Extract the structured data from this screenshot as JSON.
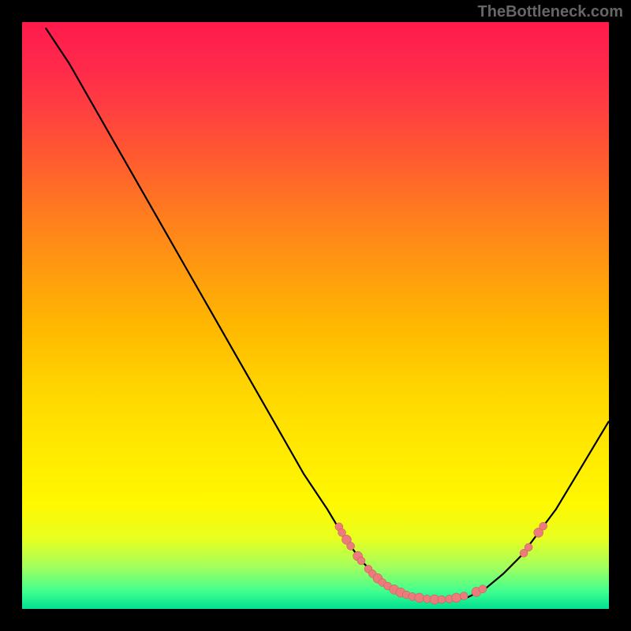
{
  "watermark": "TheBottleneck.com",
  "colors": {
    "curve": "#000000",
    "dot_fill": "#ec7b7b",
    "dot_stroke": "#c25555"
  },
  "chart_data": {
    "type": "line",
    "title": "",
    "xlabel": "",
    "ylabel": "",
    "xlim": [
      0,
      100
    ],
    "ylim": [
      0,
      100
    ],
    "note": "X and Y are normalized 0–100 across the plot area. Curve is a bottleneck V-shape; lower is better (green band at bottom).",
    "curve": [
      {
        "x": 4,
        "y": 99
      },
      {
        "x": 8,
        "y": 93
      },
      {
        "x": 12,
        "y": 86
      },
      {
        "x": 16,
        "y": 79
      },
      {
        "x": 20,
        "y": 72
      },
      {
        "x": 24,
        "y": 65
      },
      {
        "x": 28,
        "y": 58
      },
      {
        "x": 32,
        "y": 51
      },
      {
        "x": 36,
        "y": 44
      },
      {
        "x": 40,
        "y": 37
      },
      {
        "x": 44,
        "y": 30
      },
      {
        "x": 48,
        "y": 23
      },
      {
        "x": 52,
        "y": 17
      },
      {
        "x": 55,
        "y": 12
      },
      {
        "x": 58,
        "y": 8
      },
      {
        "x": 61,
        "y": 5
      },
      {
        "x": 64,
        "y": 3
      },
      {
        "x": 67,
        "y": 2
      },
      {
        "x": 70,
        "y": 1.5
      },
      {
        "x": 73,
        "y": 1.5
      },
      {
        "x": 76,
        "y": 2
      },
      {
        "x": 79,
        "y": 3.5
      },
      {
        "x": 82,
        "y": 6
      },
      {
        "x": 85,
        "y": 9
      },
      {
        "x": 88,
        "y": 13
      },
      {
        "x": 91,
        "y": 17
      },
      {
        "x": 94,
        "y": 22
      },
      {
        "x": 97,
        "y": 27
      },
      {
        "x": 100,
        "y": 32
      }
    ],
    "points": [
      {
        "x": 54.0,
        "y": 14.0,
        "r": 5
      },
      {
        "x": 54.5,
        "y": 13.0,
        "r": 5
      },
      {
        "x": 55.3,
        "y": 11.8,
        "r": 6
      },
      {
        "x": 56.0,
        "y": 10.7,
        "r": 5
      },
      {
        "x": 57.2,
        "y": 9.0,
        "r": 6
      },
      {
        "x": 57.8,
        "y": 8.2,
        "r": 5
      },
      {
        "x": 59.0,
        "y": 6.8,
        "r": 5
      },
      {
        "x": 59.7,
        "y": 6.0,
        "r": 5
      },
      {
        "x": 60.6,
        "y": 5.2,
        "r": 6
      },
      {
        "x": 61.4,
        "y": 4.5,
        "r": 5
      },
      {
        "x": 62.3,
        "y": 3.9,
        "r": 5
      },
      {
        "x": 63.4,
        "y": 3.3,
        "r": 6
      },
      {
        "x": 64.5,
        "y": 2.8,
        "r": 6
      },
      {
        "x": 65.5,
        "y": 2.4,
        "r": 5
      },
      {
        "x": 66.5,
        "y": 2.1,
        "r": 5
      },
      {
        "x": 67.7,
        "y": 1.9,
        "r": 6
      },
      {
        "x": 69.0,
        "y": 1.7,
        "r": 5
      },
      {
        "x": 70.3,
        "y": 1.6,
        "r": 6
      },
      {
        "x": 71.5,
        "y": 1.6,
        "r": 5
      },
      {
        "x": 72.8,
        "y": 1.7,
        "r": 5
      },
      {
        "x": 74.0,
        "y": 1.9,
        "r": 6
      },
      {
        "x": 75.3,
        "y": 2.2,
        "r": 5
      },
      {
        "x": 77.4,
        "y": 2.9,
        "r": 6
      },
      {
        "x": 78.5,
        "y": 3.4,
        "r": 5
      },
      {
        "x": 85.5,
        "y": 9.5,
        "r": 5
      },
      {
        "x": 86.3,
        "y": 10.5,
        "r": 5
      },
      {
        "x": 88.0,
        "y": 13.0,
        "r": 6
      },
      {
        "x": 88.8,
        "y": 14.1,
        "r": 5
      }
    ]
  }
}
